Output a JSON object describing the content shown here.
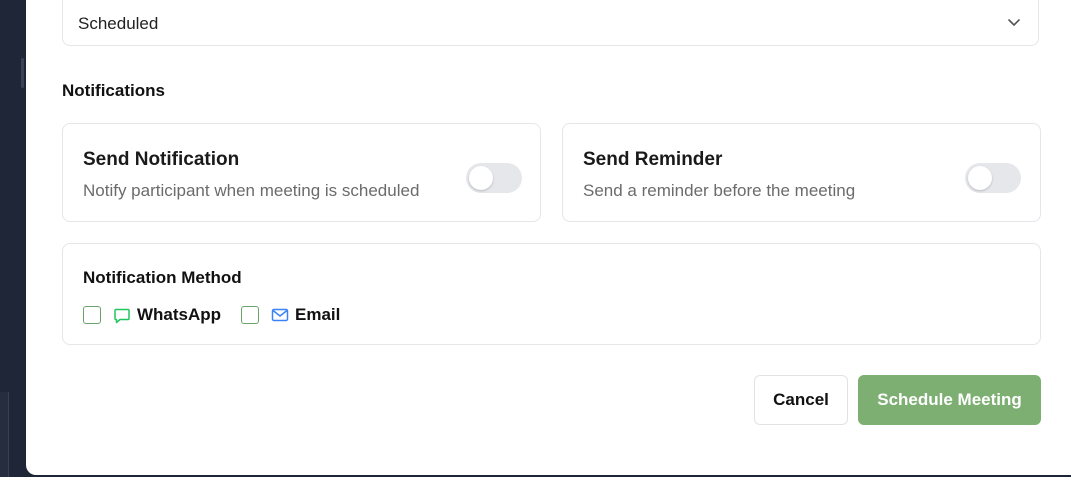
{
  "status_select": {
    "value": "Scheduled",
    "icon": "chevron-down-icon"
  },
  "notifications": {
    "section_title": "Notifications",
    "send_notification": {
      "title": "Send Notification",
      "description": "Notify participant when meeting is scheduled",
      "enabled": false
    },
    "send_reminder": {
      "title": "Send Reminder",
      "description": "Send a reminder before the meeting",
      "enabled": false
    }
  },
  "notification_method": {
    "title": "Notification Method",
    "options": [
      {
        "label": "WhatsApp",
        "icon": "message-icon",
        "checked": false,
        "color": "#22c55e"
      },
      {
        "label": "Email",
        "icon": "mail-icon",
        "checked": false,
        "color": "#3b82f6"
      }
    ]
  },
  "actions": {
    "cancel_label": "Cancel",
    "submit_label": "Schedule Meeting",
    "submit_color": "#7dae72"
  }
}
